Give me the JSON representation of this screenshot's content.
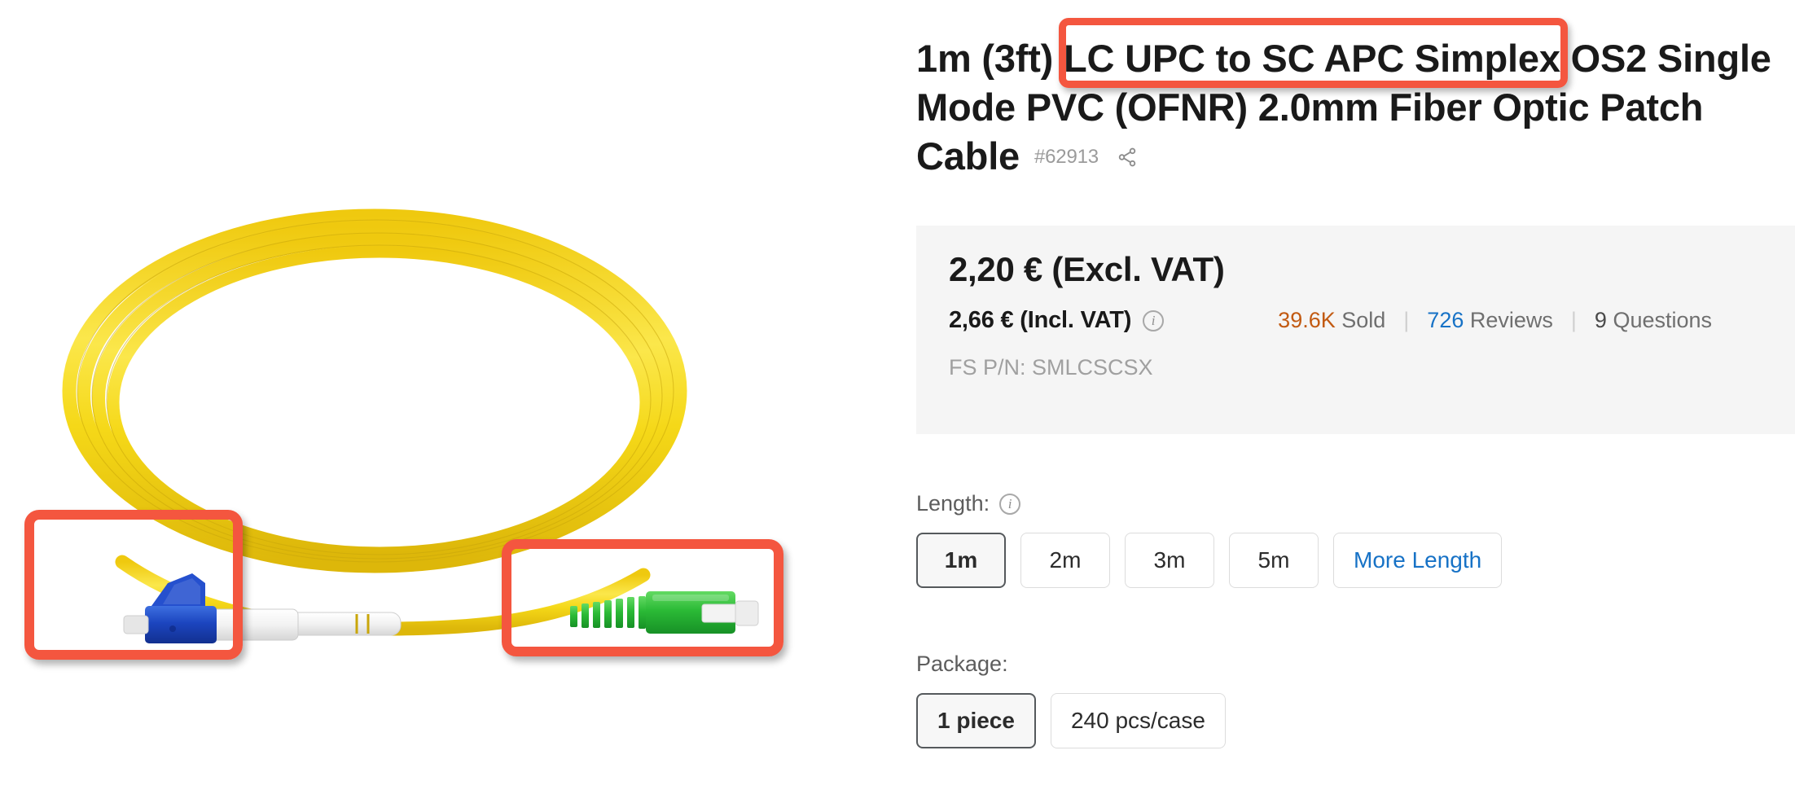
{
  "product": {
    "title_parts": {
      "before": "1m (3ft) ",
      "highlight": "LC UPC to SC APC Simplex",
      "after": " OS2 Single Mode PVC (OFNR) 2.0mm Fiber Optic Patch Cable"
    },
    "title_full": "1m (3ft) LC UPC to SC APC Simplex OS2 Single Mode PVC (OFNR) 2.0mm Fiber Optic Patch Cable",
    "sku": "#62913",
    "share_icon": "share-icon"
  },
  "price": {
    "excl_vat": "2,20 € (Excl. VAT)",
    "incl_vat": "2,66 € (Incl. VAT)",
    "vat_info_icon": "info-icon",
    "part_number": "FS P/N: SMLCSCSX"
  },
  "stats": {
    "sold_value": "39.6K",
    "sold_label": " Sold",
    "reviews_value": "726",
    "reviews_label": " Reviews",
    "questions_value": "9",
    "questions_label": " Questions",
    "separator": "|"
  },
  "options": {
    "length": {
      "label": "Length:",
      "info_icon": "info-icon",
      "buttons": [
        {
          "label": "1m",
          "selected": true,
          "link": false
        },
        {
          "label": "2m",
          "selected": false,
          "link": false
        },
        {
          "label": "3m",
          "selected": false,
          "link": false
        },
        {
          "label": "5m",
          "selected": false,
          "link": false
        },
        {
          "label": "More Length",
          "selected": false,
          "link": true
        }
      ]
    },
    "package": {
      "label": "Package:",
      "buttons": [
        {
          "label": "1 piece",
          "selected": true,
          "link": false
        },
        {
          "label": "240 pcs/case",
          "selected": false,
          "link": false
        }
      ]
    }
  },
  "image": {
    "alt": "Yellow simplex fiber optic patch cable coiled, with blue LC UPC connector at left and green SC APC connector at right",
    "cable_color": "#F2D518",
    "lc_connector_color": "#1D4FC4",
    "sc_connector_color": "#2FBE3A",
    "annotations": [
      {
        "name": "lc-upc-connector-highlight",
        "color": "#F4563F"
      },
      {
        "name": "sc-apc-connector-highlight",
        "color": "#F4563F"
      },
      {
        "name": "title-phrase-highlight",
        "color": "#F4563F"
      }
    ]
  }
}
